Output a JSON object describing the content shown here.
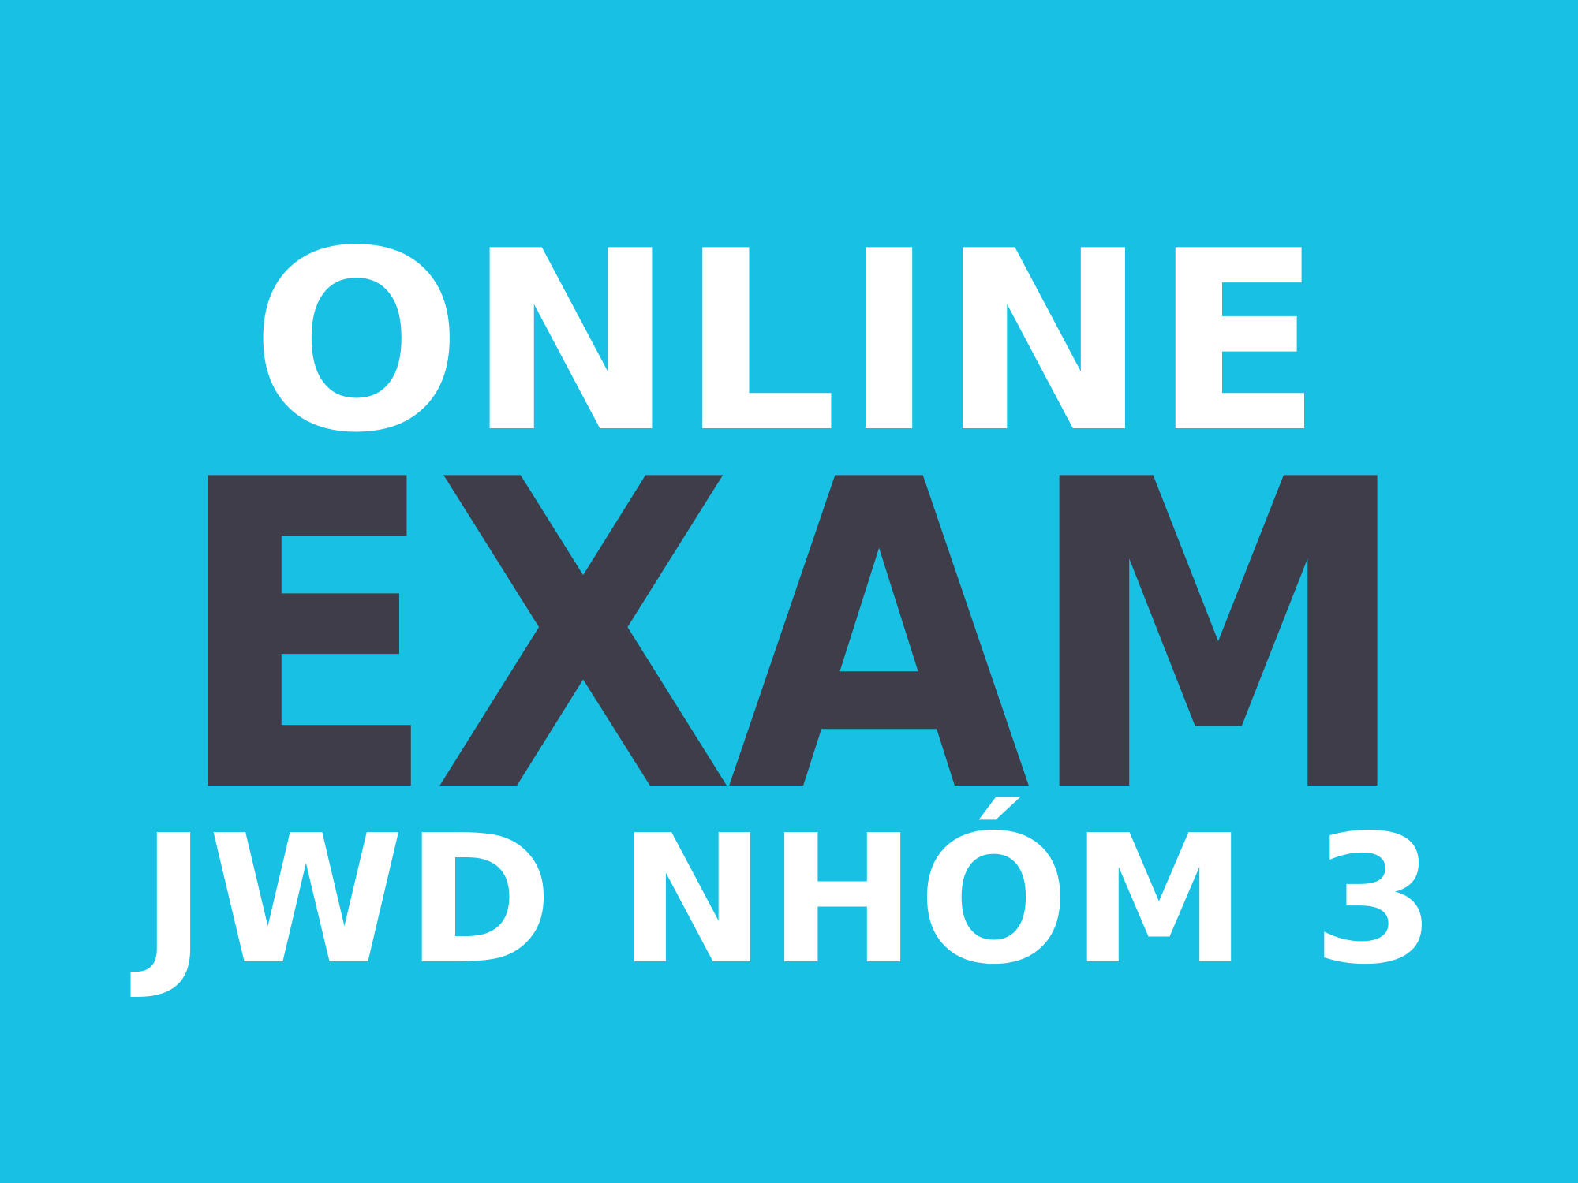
{
  "title": {
    "line1": "ONLINE",
    "line2": "EXAM",
    "line3": "JWD NHÓM 3"
  },
  "colors": {
    "background": "#18c0e3",
    "primary_text": "#ffffff",
    "accent_text": "#3e3d49"
  }
}
